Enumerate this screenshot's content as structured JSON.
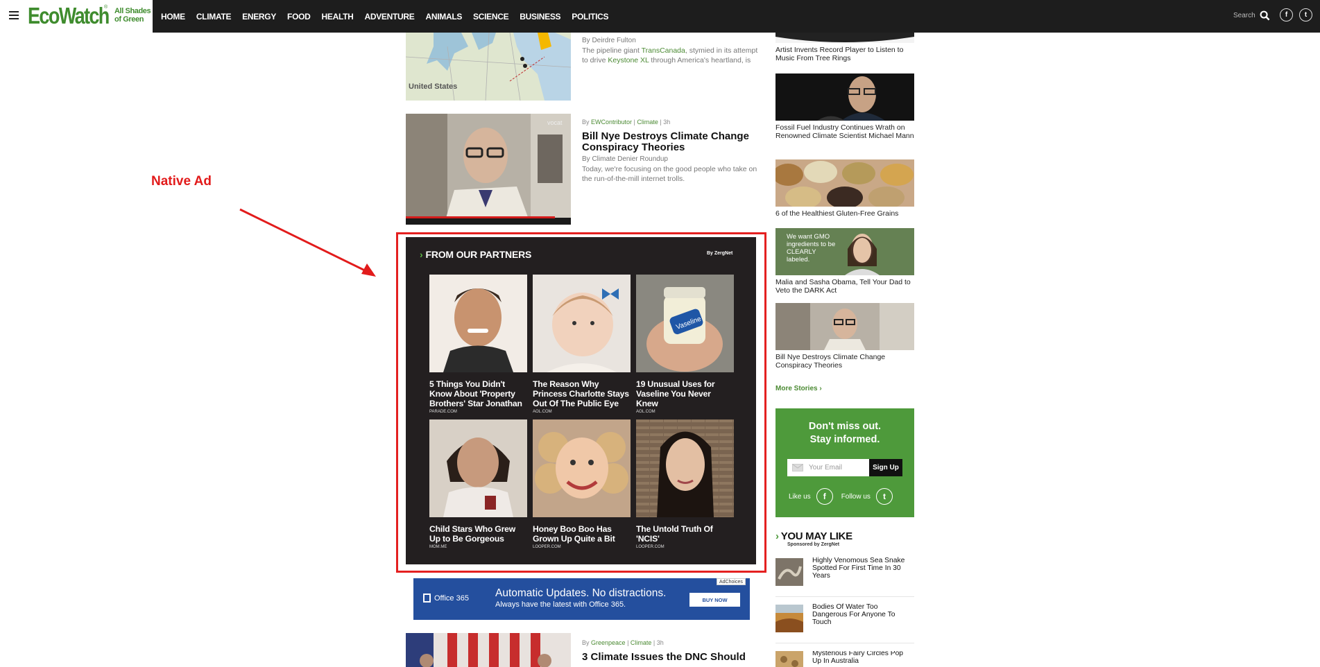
{
  "header": {
    "logo": "EcoWatch",
    "logo_mark": "®",
    "tagline_line1": "All Shades",
    "tagline_line2": "of Green",
    "nav": [
      "HOME",
      "CLIMATE",
      "ENERGY",
      "FOOD",
      "HEALTH",
      "ADVENTURE",
      "ANIMALS",
      "SCIENCE",
      "BUSINESS",
      "POLITICS"
    ],
    "search_label": "Search",
    "facebook_glyph": "f",
    "twitter_glyph": "t"
  },
  "annotation": {
    "label": "Native Ad",
    "color": "#e21b1b"
  },
  "stories": [
    {
      "author": "By Deirdre Fulton",
      "excerpt_pre": "The pipeline giant ",
      "excerpt_link1": "TransCanada",
      "excerpt_mid": ", stymied in its attempt to drive ",
      "excerpt_link2": "Keystone XL",
      "excerpt_post": " through America's heartland, is",
      "map_label": "United States"
    },
    {
      "meta_by": "By ",
      "meta_author": "EWContributor",
      "meta_sep": " | ",
      "meta_cat": "Climate",
      "meta_time": " | 3h",
      "title": "Bill Nye Destroys Climate Change Conspiracy Theories",
      "author": "By Climate Denier Roundup",
      "excerpt": "Today, we're focusing on the good people who take on the run-of-the-mill internet trolls."
    },
    {
      "meta_by": "By ",
      "meta_author": "Greenpeace",
      "meta_sep": " | ",
      "meta_cat": "Climate",
      "meta_time": " | 3h",
      "title": "3 Climate Issues the DNC Should"
    }
  ],
  "partners": {
    "heading": "FROM OUR PARTNERS",
    "by": "By ZergNet",
    "items": [
      {
        "title": "5 Things You Didn't Know About 'Property Brothers' Star Jonathan",
        "source": "PARADE.COM"
      },
      {
        "title": "The Reason Why Princess Charlotte Stays Out Of The Public Eye",
        "source": "AOL.COM"
      },
      {
        "title": "19 Unusual Uses for Vaseline You Never Knew",
        "source": "AOL.COM"
      },
      {
        "title": "Child Stars Who Grew Up to Be Gorgeous",
        "source": "MOM.ME"
      },
      {
        "title": "Honey Boo Boo Has Grown Up Quite a Bit",
        "source": "LOOPER.COM"
      },
      {
        "title": "The Untold Truth Of 'NCIS'",
        "source": "LOOPER.COM"
      }
    ]
  },
  "office_ad": {
    "brand": "Office 365",
    "headline": "Automatic Updates. No distractions.",
    "subline": "Always have the latest with Office 365.",
    "cta": "BUY NOW",
    "adchoices": "AdChoices"
  },
  "sidebar": {
    "items": [
      {
        "title": "Artist Invents Record Player to Listen to Music From Tree Rings"
      },
      {
        "title": "Fossil Fuel Industry Continues Wrath on Renowned Climate Scientist Michael Mann"
      },
      {
        "title": "6 of the Healthiest Gluten-Free Grains"
      },
      {
        "title": "Malia and Sasha Obama, Tell Your Dad to Veto the DARK Act",
        "image_text": "We want GMO ingredients to be CLEARLY labeled."
      },
      {
        "title": "Bill Nye Destroys Climate Change Conspiracy Theories"
      }
    ],
    "more_stories": "More Stories ›",
    "newsletter": {
      "line1": "Don't miss out.",
      "line2": "Stay informed.",
      "email_placeholder": "Your Email",
      "signup": "Sign Up",
      "like_us": "Like us",
      "follow_us": "Follow us"
    },
    "you_may_like": {
      "heading": "YOU MAY LIKE",
      "sponsor": "Sponsored by ZergNet",
      "items": [
        {
          "title": "Highly Venomous Sea Snake Spotted For First Time In 30 Years"
        },
        {
          "title": "Bodies Of Water Too Dangerous For Anyone To Touch"
        },
        {
          "title": "Mysterious Fairy Circles Pop Up In Australia"
        }
      ]
    }
  }
}
